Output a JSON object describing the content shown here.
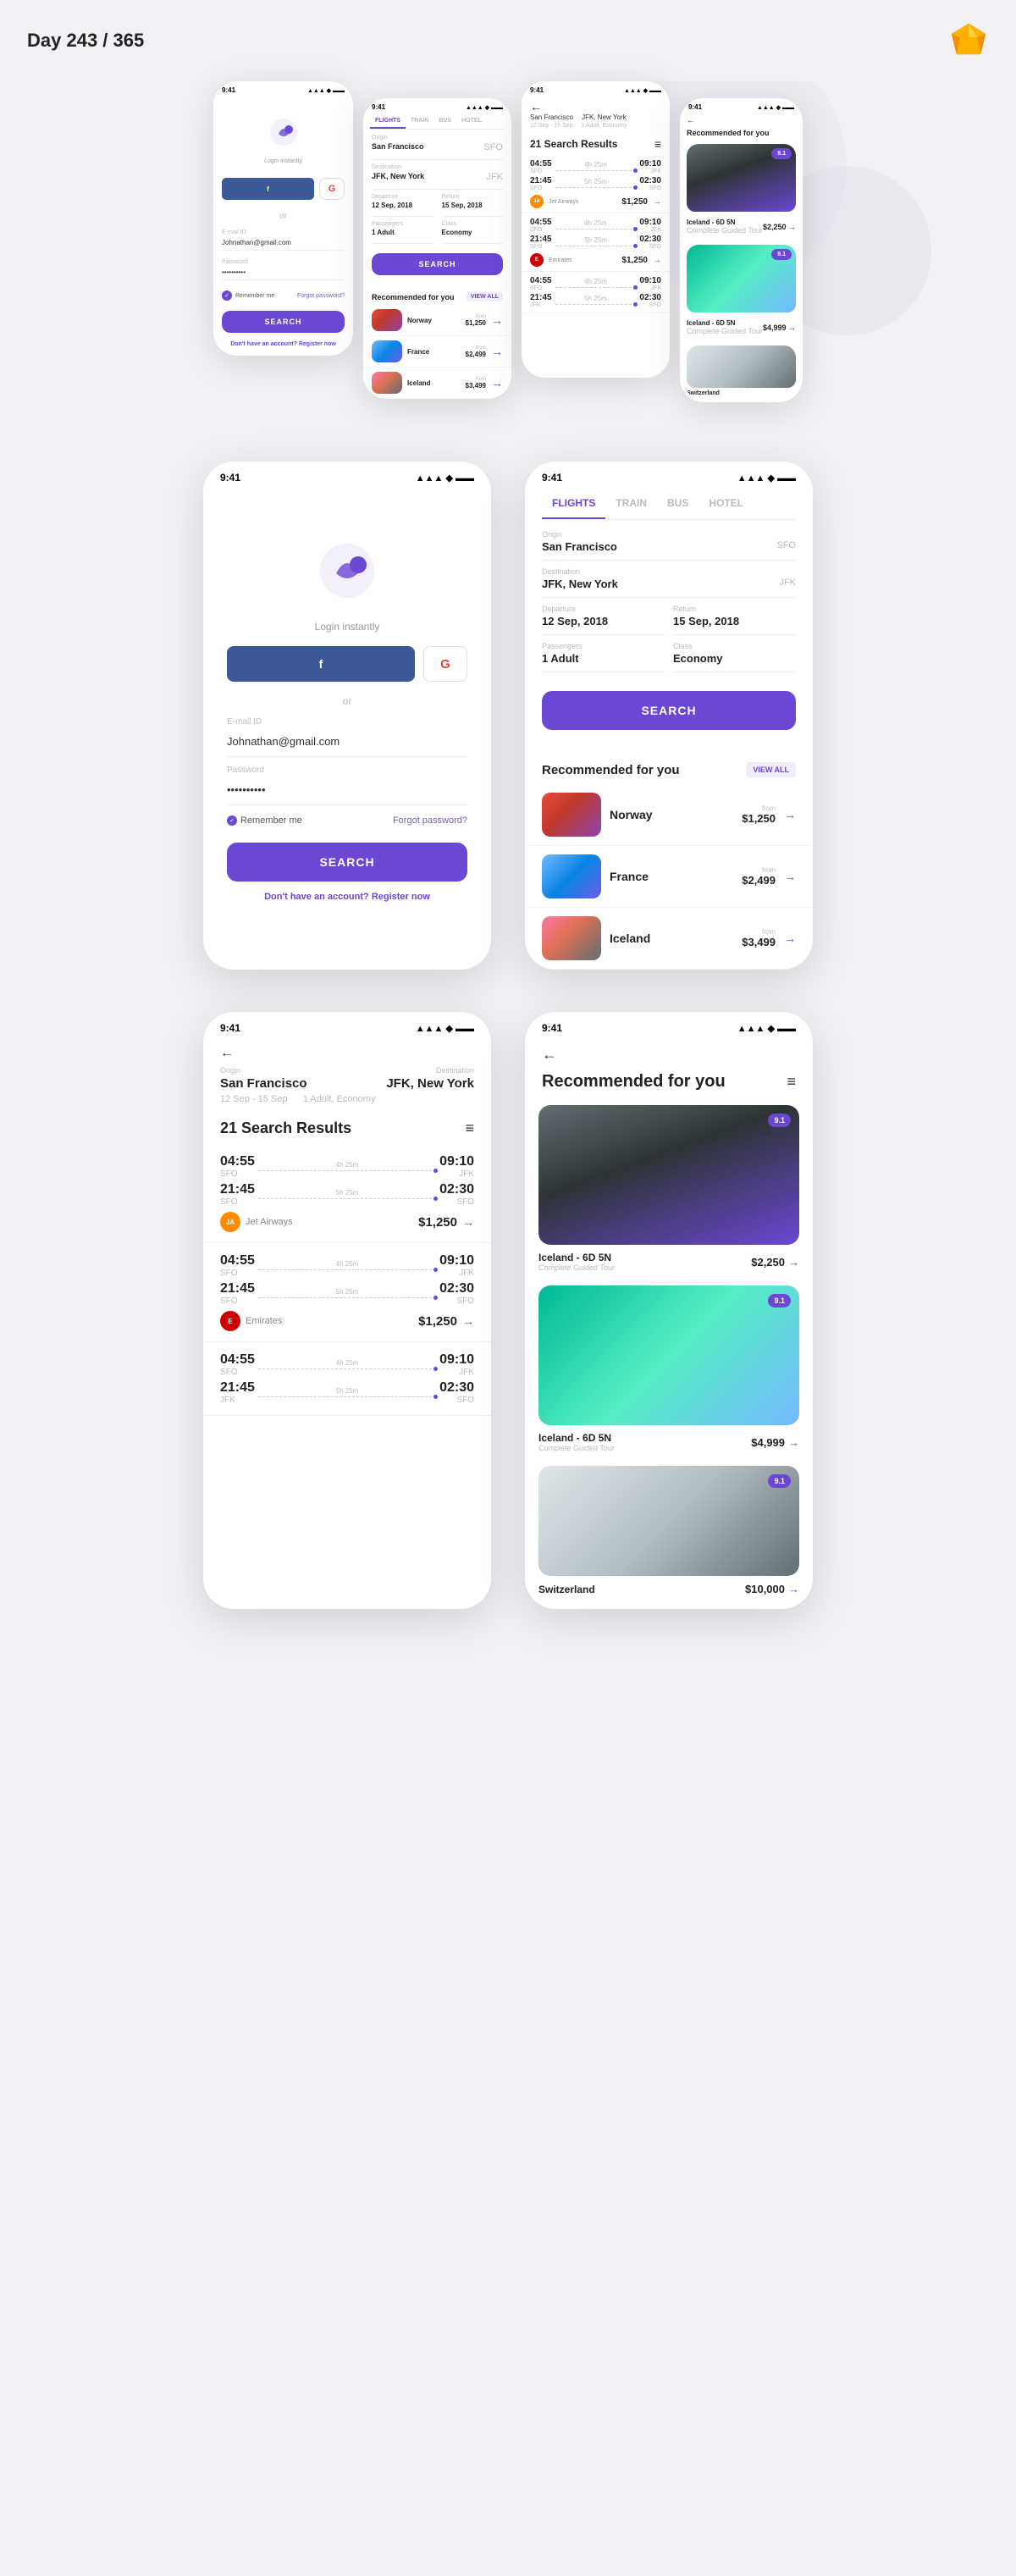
{
  "header": {
    "title": "Day 243 / 365"
  },
  "statusBar": {
    "time": "9:41"
  },
  "tabs": {
    "items": [
      "FLIGHTS",
      "TRAIN",
      "BUS",
      "HOTEL"
    ],
    "active": 0
  },
  "loginScreen": {
    "logoAlt": "app logo",
    "loginInstantly": "Login instantly",
    "facebookLabel": "f",
    "googleLabel": "G",
    "or": "or",
    "emailLabel": "E-mail ID",
    "emailValue": "Johnathan@gmail.com",
    "passwordLabel": "Password",
    "passwordValue": "••••••••••",
    "rememberLabel": "Remember me",
    "forgotLabel": "Forgot password?",
    "searchLabel": "SEARCH",
    "noAccountLabel": "Don't have an account?",
    "registerLabel": "Register now"
  },
  "searchScreen": {
    "originLabel": "Origin",
    "originValue": "San Francisco",
    "originCode": "SFO",
    "destLabel": "Destination",
    "destValue": "JFK, New York",
    "destCode": "JFK",
    "departureLabel": "Departure",
    "departureValue": "12 Sep, 2018",
    "returnLabel": "Return",
    "returnValue": "15 Sep, 2018",
    "passengersLabel": "Passengers",
    "passengersValue": "1 Adult",
    "classLabel": "Class",
    "classValue": "Economy",
    "searchLabel": "SEARCH",
    "recommendedTitle": "Recommended for you",
    "viewAllLabel": "VIEW ALL",
    "recommendations": [
      {
        "name": "Norway",
        "from": "from",
        "price": "$1,250",
        "imgClass": "img-norway"
      },
      {
        "name": "France",
        "from": "from",
        "price": "$2,499",
        "imgClass": "img-france"
      },
      {
        "name": "Iceland",
        "from": "from",
        "price": "$3,499",
        "imgClass": "img-iceland-1"
      }
    ]
  },
  "resultsScreen": {
    "origin": "San Francisco",
    "destination": "JFK, New York",
    "dates": "12 Sep - 15 Sep",
    "passengers": "1 Adult, Economy",
    "resultCount": "21 Search Results",
    "flights": [
      {
        "depTime": "04:55",
        "depCode": "SFO",
        "duration": "4h 25m",
        "arrTime": "09:10",
        "arrCode": "JFK",
        "depTime2": "21:45",
        "depCode2": "SFO",
        "duration2": "5h 25m",
        "arrTime2": "02:30",
        "arrCode2": "SFO",
        "airline": "Jet Airways",
        "airlineColor": "#ff8c00",
        "price": "$1,250"
      },
      {
        "depTime": "04:55",
        "depCode": "SFO",
        "duration": "4h 25m",
        "arrTime": "09:10",
        "arrCode": "JFK",
        "depTime2": "21:45",
        "depCode2": "SFO",
        "duration2": "5h 25m",
        "arrTime2": "02:30",
        "arrCode2": "SFO",
        "airline": "Emirates",
        "airlineColor": "#cc0001",
        "price": "$1,250"
      },
      {
        "depTime": "04:55",
        "depCode": "SFO",
        "duration": "4h 25m",
        "arrTime": "09:10",
        "arrCode": "JFK",
        "depTime2": "21:45",
        "depCode2": "JFK",
        "duration2": "5h 25m",
        "arrTime2": "02:30",
        "arrCode2": "SFO"
      }
    ]
  },
  "recommendedCardsScreen": {
    "title": "Recommended for you",
    "cards": [
      {
        "name": "Iceland - 6D 5N",
        "tour": "Complete Guided Tour",
        "price": "$2,250",
        "badge": "9.1",
        "imgClass": "img-iceland-card"
      },
      {
        "name": "Iceland - 6D 5N",
        "tour": "Complete Guided Tour",
        "price": "$4,999",
        "badge": "9.1",
        "imgClass": "img-iceland-green"
      },
      {
        "name": "Switzerland",
        "tour": "",
        "price": "$10,000",
        "badge": "9.1",
        "imgClass": "img-switzerland"
      }
    ]
  }
}
